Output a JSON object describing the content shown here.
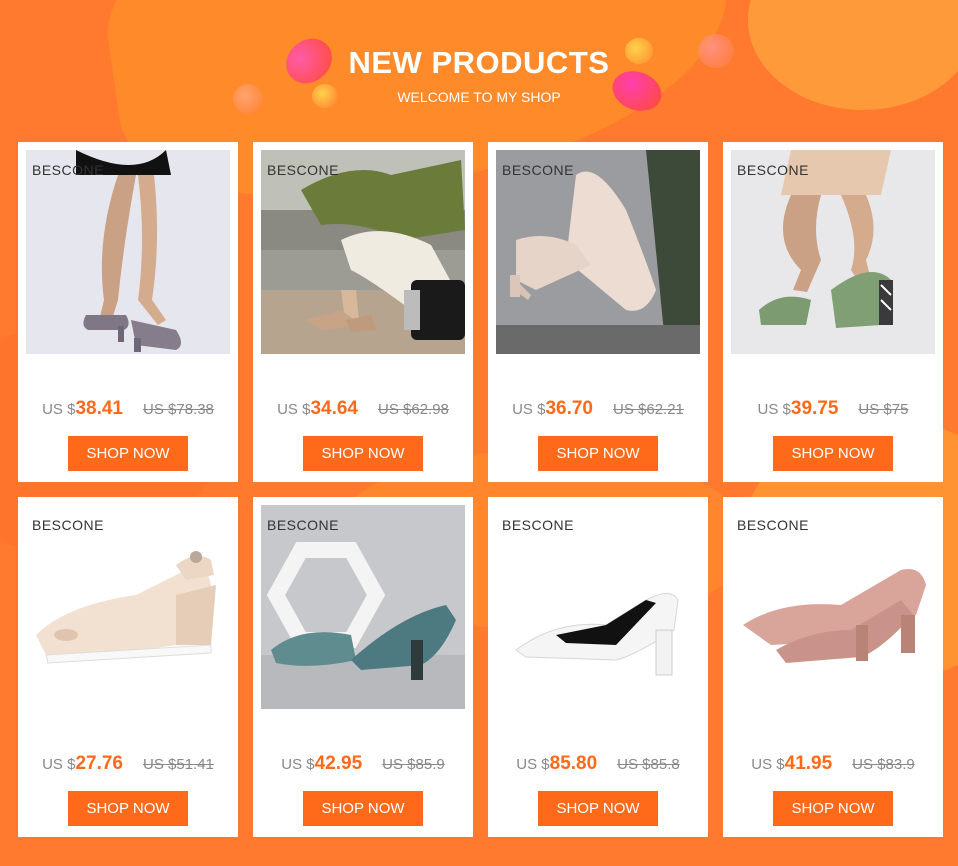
{
  "header": {
    "title": "NEW PRODUCTS",
    "subtitle": "WELCOME TO MY SHOP"
  },
  "brand": "BESCONE",
  "products": [
    {
      "currency": "US $",
      "price": "38.41",
      "old_price": "US $78.38",
      "button": "SHOP NOW",
      "image": "legs-grey-block-heel-pumps"
    },
    {
      "currency": "US $",
      "price": "34.64",
      "old_price": "US $62.98",
      "button": "SHOP NOW",
      "image": "nude-pointed-pumps-seated-model"
    },
    {
      "currency": "US $",
      "price": "36.70",
      "old_price": "US $62.21",
      "button": "SHOP NOW",
      "image": "beige-block-heel-pumps"
    },
    {
      "currency": "US $",
      "price": "39.75",
      "old_price": "US $75",
      "button": "SHOP NOW",
      "image": "green-pumps-striped-heel"
    },
    {
      "currency": "US $",
      "price": "27.76",
      "old_price": "US $51.41",
      "button": "SHOP NOW",
      "image": "beige-peep-toe-wedge-slingback"
    },
    {
      "currency": "US $",
      "price": "42.95",
      "old_price": "US $85.9",
      "button": "SHOP NOW",
      "image": "teal-metallic-pumps-hexagon"
    },
    {
      "currency": "US $",
      "price": "85.80",
      "old_price": "US $85.8",
      "button": "SHOP NOW",
      "image": "white-black-pointed-pump"
    },
    {
      "currency": "US $",
      "price": "41.95",
      "old_price": "US $83.9",
      "button": "SHOP NOW",
      "image": "pink-patent-pumps"
    }
  ],
  "colors": {
    "background": "#ff7a2e",
    "accent": "#ff6a1a",
    "card": "#ffffff"
  }
}
